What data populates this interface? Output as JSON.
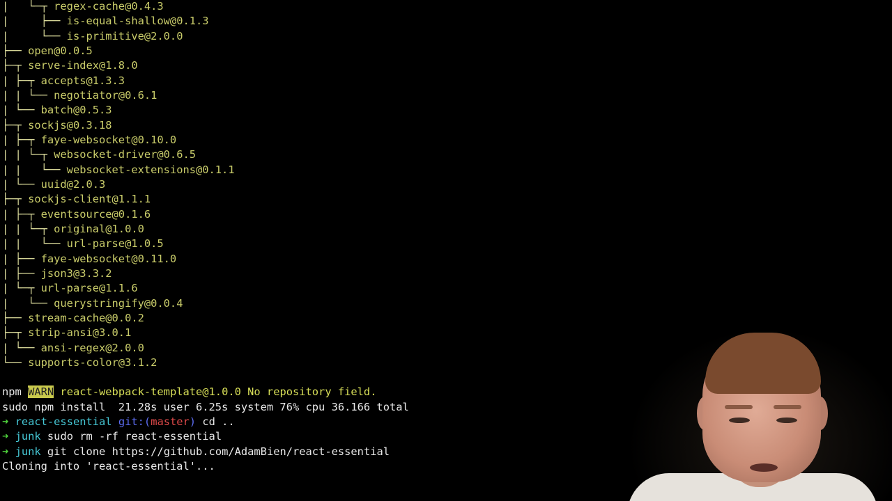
{
  "tree": [
    {
      "guide": "|   └─┬ ",
      "pkg": "regex-cache@0.4.3"
    },
    {
      "guide": "|     ├── ",
      "pkg": "is-equal-shallow@0.1.3"
    },
    {
      "guide": "|     └── ",
      "pkg": "is-primitive@2.0.0"
    },
    {
      "guide": "├── ",
      "pkg": "open@0.0.5"
    },
    {
      "guide": "├─┬ ",
      "pkg": "serve-index@1.8.0"
    },
    {
      "guide": "| ├─┬ ",
      "pkg": "accepts@1.3.3"
    },
    {
      "guide": "| | └── ",
      "pkg": "negotiator@0.6.1"
    },
    {
      "guide": "| └── ",
      "pkg": "batch@0.5.3"
    },
    {
      "guide": "├─┬ ",
      "pkg": "sockjs@0.3.18"
    },
    {
      "guide": "| ├─┬ ",
      "pkg": "faye-websocket@0.10.0"
    },
    {
      "guide": "| | └─┬ ",
      "pkg": "websocket-driver@0.6.5"
    },
    {
      "guide": "| |   └── ",
      "pkg": "websocket-extensions@0.1.1"
    },
    {
      "guide": "| └── ",
      "pkg": "uuid@2.0.3"
    },
    {
      "guide": "├─┬ ",
      "pkg": "sockjs-client@1.1.1"
    },
    {
      "guide": "| ├─┬ ",
      "pkg": "eventsource@0.1.6"
    },
    {
      "guide": "| | └─┬ ",
      "pkg": "original@1.0.0"
    },
    {
      "guide": "| |   └── ",
      "pkg": "url-parse@1.0.5"
    },
    {
      "guide": "| ├── ",
      "pkg": "faye-websocket@0.11.0"
    },
    {
      "guide": "| ├── ",
      "pkg": "json3@3.3.2"
    },
    {
      "guide": "| └─┬ ",
      "pkg": "url-parse@1.1.6"
    },
    {
      "guide": "|   └── ",
      "pkg": "querystringify@0.0.4"
    },
    {
      "guide": "├── ",
      "pkg": "stream-cache@0.0.2"
    },
    {
      "guide": "├─┬ ",
      "pkg": "strip-ansi@3.0.1"
    },
    {
      "guide": "| └── ",
      "pkg": "ansi-regex@2.0.0"
    },
    {
      "guide": "└── ",
      "pkg": "supports-color@3.1.2"
    }
  ],
  "warn_line": {
    "prefix": "npm ",
    "badge": "WARN",
    "message": " react-webpack-template@1.0.0 No repository field."
  },
  "timing_line": "sudo npm install  21.28s user 6.25s system 76% cpu 36.166 total",
  "prompt1": {
    "arrow": "➜",
    "dir": "react-essential",
    "git_label": "git:(",
    "branch": "master",
    "git_close": ")",
    "cmd": " cd .."
  },
  "prompt2": {
    "arrow": "➜",
    "dir": "junk",
    "cmd": " sudo rm -rf react-essential"
  },
  "prompt3": {
    "arrow": "➜",
    "dir": "junk",
    "cmd": " git clone https://github.com/AdamBien/react-essential"
  },
  "clone_line": "Cloning into 'react-essential'...",
  "colors": {
    "background": "#000000",
    "tree_text": "#c9cc6a",
    "prompt_arrow": "#4fd43d",
    "dir": "#46c8d6",
    "git": "#5c6cf0",
    "branch": "#e04a4a",
    "warn_badge": "#c9c94d"
  }
}
